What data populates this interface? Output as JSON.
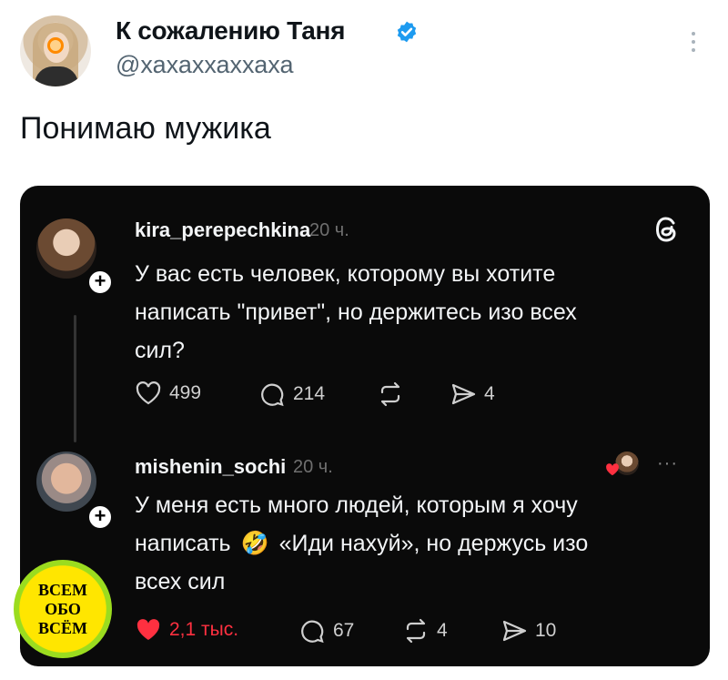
{
  "tweet": {
    "author": {
      "display_name": "К сожалению Таня",
      "handle": "@хахаххаххаха",
      "verified": true
    },
    "text": "Понимаю мужика",
    "icons": {
      "verified": "verified-badge-icon",
      "more": "more-vertical-icon"
    },
    "colors": {
      "verified": "#1d9bf0",
      "handle": "#536471"
    }
  },
  "embed": {
    "platform_icon": "threads-logo-icon",
    "posts": [
      {
        "username": "kira_perepechkina",
        "time": "20 ч.",
        "text_lines": [
          "У вас есть человек, которому вы хотите",
          "написать \"привет\", но держитесь изо всех",
          "сил?"
        ],
        "actions": {
          "likes": "499",
          "comments": "214",
          "reposts": "",
          "shares": "4"
        }
      },
      {
        "username": "mishenin_sochi",
        "time": "20 ч.",
        "text_line1": "У меня есть много людей, которым я хочу",
        "text_line2_before": "написать",
        "emoji": "🤣",
        "text_line2_after": "«Иди нахуй», но держусь изо",
        "text_line3": "всех сил",
        "more_label": "···",
        "actions": {
          "likes": "2,1 тыс.",
          "comments": "67",
          "reposts": "4",
          "shares": "10"
        },
        "liked": true
      }
    ],
    "colors": {
      "background": "#0a0a0a",
      "like_active": "#ff3040"
    }
  },
  "watermark": {
    "lines": [
      "ВСЕМ",
      "ОБО",
      "ВСЁМ"
    ]
  }
}
